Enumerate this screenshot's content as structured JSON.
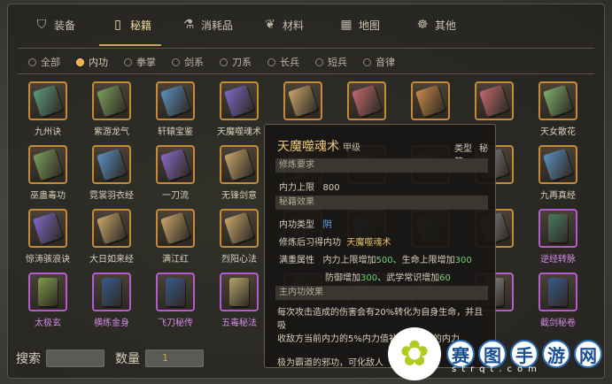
{
  "tabs": [
    {
      "label": "装备",
      "icon": "armor-icon"
    },
    {
      "label": "秘籍",
      "icon": "book-icon",
      "active": true
    },
    {
      "label": "消耗品",
      "icon": "potion-icon"
    },
    {
      "label": "材料",
      "icon": "herb-icon"
    },
    {
      "label": "地图",
      "icon": "map-icon"
    },
    {
      "label": "其他",
      "icon": "misc-icon"
    }
  ],
  "filters": [
    {
      "label": "全部"
    },
    {
      "label": "内功",
      "active": true
    },
    {
      "label": "拳掌"
    },
    {
      "label": "剑系"
    },
    {
      "label": "刀系"
    },
    {
      "label": "长兵"
    },
    {
      "label": "短兵"
    },
    {
      "label": "音律"
    }
  ],
  "items": [
    {
      "name": "九州诀",
      "color": "#5d9a7f",
      "rarity": "orange"
    },
    {
      "name": "紫游龙气",
      "color": "#7b9f5a",
      "rarity": "orange"
    },
    {
      "name": "轩辕宝鉴",
      "color": "#5a8fc0",
      "rarity": "orange"
    },
    {
      "name": "天魔噬魂术",
      "color": "#7c6ac8",
      "rarity": "orange"
    },
    {
      "name": "",
      "color": "#c9a46a",
      "rarity": "orange"
    },
    {
      "name": "",
      "color": "#c06a6a",
      "rarity": "orange"
    },
    {
      "name": "",
      "color": "#c98a48",
      "rarity": "orange"
    },
    {
      "name": "",
      "color": "#c06a6a",
      "rarity": "orange"
    },
    {
      "name": "天女散花",
      "color": "#7fb06a",
      "rarity": "orange"
    },
    {
      "name": "巫蛊毒功",
      "color": "#7b9f5a",
      "rarity": "orange"
    },
    {
      "name": "霓裳羽衣经",
      "color": "#5a8fc0",
      "rarity": "orange"
    },
    {
      "name": "一刀流",
      "color": "#8a6ac8",
      "rarity": "orange"
    },
    {
      "name": "无锋剑意",
      "color": "#c9a46a",
      "rarity": "orange"
    },
    {
      "name": "",
      "color": "#c9a46a",
      "rarity": "orange"
    },
    {
      "name": "",
      "color": "#8a8a8a",
      "rarity": "orange"
    },
    {
      "name": "",
      "color": "#8a8a8a",
      "rarity": "orange"
    },
    {
      "name": "",
      "color": "#8a8a8a",
      "rarity": "orange"
    },
    {
      "name": "九再真经",
      "color": "#5a8fc0",
      "rarity": "orange"
    },
    {
      "name": "惊涛骇浪诀",
      "color": "#7c6ac8",
      "rarity": "orange"
    },
    {
      "name": "大日如来经",
      "color": "#c9a46a",
      "rarity": "orange"
    },
    {
      "name": "满江红",
      "color": "#c9a46a",
      "rarity": "orange"
    },
    {
      "name": "烈阳心法",
      "color": "#c9a46a",
      "rarity": "orange"
    },
    {
      "name": "",
      "color": "#8a8a8a",
      "rarity": "orange"
    },
    {
      "name": "",
      "color": "#8a8a8a",
      "rarity": "orange"
    },
    {
      "name": "",
      "color": "#8a8a8a",
      "rarity": "orange"
    },
    {
      "name": "",
      "color": "#8a8a8a",
      "rarity": "orange"
    },
    {
      "name": "逆经转脉",
      "color": "#4a7a63",
      "rarity": "purple"
    },
    {
      "name": "太极玄",
      "color": "#7f9a4a",
      "rarity": "purple"
    },
    {
      "name": "横练金身",
      "color": "#3a5a8a",
      "rarity": "purple"
    },
    {
      "name": "飞刀秘传",
      "color": "#3a5a8a",
      "rarity": "purple"
    },
    {
      "name": "五毒秘法",
      "color": "#b5a36a",
      "rarity": "purple"
    },
    {
      "name": "",
      "color": "#8a8a8a",
      "rarity": "purple"
    },
    {
      "name": "",
      "color": "#8a8a8a",
      "rarity": "purple"
    },
    {
      "name": "",
      "color": "#8a8a8a",
      "rarity": "purple"
    },
    {
      "name": "",
      "color": "#8a8a8a",
      "rarity": "purple"
    },
    {
      "name": "截剑秘卷",
      "color": "#3a5a8a",
      "rarity": "purple"
    }
  ],
  "search": {
    "label": "搜索",
    "value": ""
  },
  "quantity": {
    "label": "数量",
    "value": "1"
  },
  "tooltip": {
    "title": "天魔噬魂术",
    "grade": "甲级",
    "type_label": "类型",
    "type_value": "秘籍",
    "req_header": "修炼要求",
    "req_label": "内力上限",
    "req_value": "800",
    "effect_header": "秘籍效果",
    "kind_label": "内功类型",
    "kind_value": "阴",
    "learn_label": "修炼后习得内功",
    "learn_value": "天魔噬魂术",
    "attr_label": "满重属性",
    "attr1_a": "内力上限增加",
    "attr1_b": "500",
    "attr1_c": "、生命上限增加",
    "attr1_d": "300",
    "attr2_a": "防御增加",
    "attr2_b": "300",
    "attr2_c": "、武学常识增加",
    "attr2_d": "60",
    "main_header": "主内功效果",
    "desc1": "每次攻击造成的伤害会有20%转化为自身生命，并且吸",
    "desc2": "收敌方当前内力的5%内力值补充为自己的内力",
    "desc3": "极为霸道的邪功，可化敌人"
  },
  "watermark": {
    "chars": [
      "赛",
      "图",
      "手",
      "游",
      "网"
    ],
    "sub": "strqt.com"
  }
}
